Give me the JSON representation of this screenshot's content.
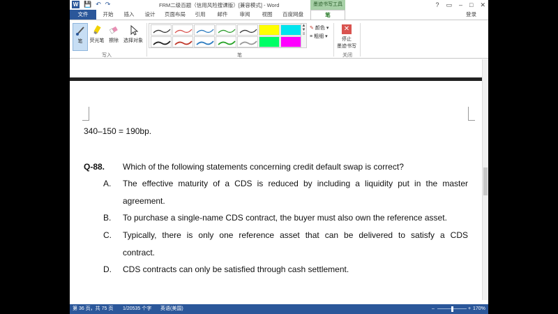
{
  "titlebar": {
    "logo": "W",
    "save": "💾",
    "undo": "↶",
    "redo": "↷",
    "title": "FRM二级百题（信用风险搜课版）[兼容模式] - Word",
    "context_tool": "墨迹书写工具",
    "win_help": "?",
    "win_restore": "▭",
    "win_min": "–",
    "win_max": "□",
    "win_close": "✕"
  },
  "tabs": {
    "file": "文件",
    "home": "开始",
    "insert": "插入",
    "design": "设计",
    "layout": "页面布局",
    "references": "引用",
    "mailings": "邮件",
    "review": "审阅",
    "view": "视图",
    "baidu": "百度网盘",
    "pen": "笔",
    "login": "登录"
  },
  "ribbon": {
    "pen": "笔",
    "highlighter": "荧光笔",
    "eraser": "擦除",
    "select": "选择对象",
    "group_write": "写入",
    "group_pens": "笔",
    "color_label": "颜色",
    "thickness_label": "粗细",
    "stop_label_1": "停止",
    "stop_label_2": "墨迹书写",
    "group_close": "关闭",
    "pen_colors": [
      "#333333",
      "#d9534f",
      "#2b7bbf",
      "#2e9e2e",
      "#3a3a3a",
      "#ffff00",
      "#00e5ee",
      "#222222",
      "#c0392b",
      "#2b7bbf",
      "#27a327",
      "#9a9a9a",
      "#00ff66",
      "#ff00ff"
    ]
  },
  "doc": {
    "line1": "340–150 = 190bp.",
    "q_num": "Q-88.",
    "q_text": "Which of the following statements concerning credit default swap is correct?",
    "a_key": "A.",
    "a_line1": "The effective maturity of a CDS is reduced by including a liquidity put in the master",
    "a_line2": "agreement.",
    "b_key": "B.",
    "b_text": "To purchase a single-name CDS contract, the buyer must also own the reference asset.",
    "c_key": "C.",
    "c_line1": "Typically, there is only one reference asset that can be delivered to satisfy a CDS",
    "c_line2": "contract.",
    "d_key": "D.",
    "d_text": "CDS contracts can only be satisfied through cash settlement."
  },
  "status": {
    "page": "第 36 页，共 75 页",
    "words": "1/20535 个字",
    "lang": "英语(美国)",
    "zoom_minus": "–",
    "zoom_plus": "+",
    "zoom": "170%"
  }
}
